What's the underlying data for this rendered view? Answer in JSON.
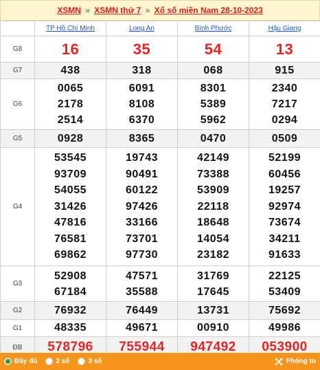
{
  "header": {
    "link1": "XSMN",
    "sep": "»",
    "link2": "XSMN thứ 7",
    "link3": "Xổ số miền Nam 28-10-2023"
  },
  "provinces": [
    "TP Hồ Chí Minh",
    "Long An",
    "Bình Phước",
    "Hậu Giang"
  ],
  "prizes": [
    {
      "label": "G8",
      "results": [
        [
          "16"
        ],
        [
          "35"
        ],
        [
          "54"
        ],
        [
          "13"
        ]
      ]
    },
    {
      "label": "G7",
      "results": [
        [
          "438"
        ],
        [
          "318"
        ],
        [
          "068"
        ],
        [
          "915"
        ]
      ]
    },
    {
      "label": "G6",
      "results": [
        [
          "0065",
          "2178",
          "2514"
        ],
        [
          "6091",
          "8108",
          "6370"
        ],
        [
          "8301",
          "5389",
          "5962"
        ],
        [
          "2340",
          "7217",
          "0294"
        ]
      ]
    },
    {
      "label": "G5",
      "results": [
        [
          "0928"
        ],
        [
          "8365"
        ],
        [
          "0470"
        ],
        [
          "0509"
        ]
      ]
    },
    {
      "label": "G4",
      "results": [
        [
          "53545",
          "93709",
          "54055",
          "31426",
          "47816",
          "76581",
          "69862"
        ],
        [
          "19743",
          "90491",
          "60122",
          "97426",
          "33166",
          "73701",
          "97730"
        ],
        [
          "42149",
          "73388",
          "53909",
          "22118",
          "18648",
          "14054",
          "23182"
        ],
        [
          "52199",
          "60456",
          "19257",
          "92974",
          "73674",
          "34211",
          "91633"
        ]
      ]
    },
    {
      "label": "G3",
      "results": [
        [
          "52908",
          "67184"
        ],
        [
          "47571",
          "35588"
        ],
        [
          "31769",
          "17645"
        ],
        [
          "22125",
          "53409"
        ]
      ]
    },
    {
      "label": "G2",
      "results": [
        [
          "76932"
        ],
        [
          "76449"
        ],
        [
          "13731"
        ],
        [
          "75692"
        ]
      ]
    },
    {
      "label": "G1",
      "results": [
        [
          "48335"
        ],
        [
          "49671"
        ],
        [
          "00910"
        ],
        [
          "49986"
        ]
      ]
    },
    {
      "label": "ĐB",
      "results": [
        [
          "578796"
        ],
        [
          "755944"
        ],
        [
          "947492"
        ],
        [
          "053900"
        ]
      ]
    }
  ],
  "footer": {
    "options": [
      {
        "label": "Đầy đủ",
        "selected": true
      },
      {
        "label": "2 số",
        "selected": false
      },
      {
        "label": "3 số",
        "selected": false
      }
    ],
    "zoom_label": "Phóng to"
  },
  "colors": {
    "accent_red": "#e02525",
    "footer_orange": "#f6951b",
    "header_bg": "#fff6cf",
    "link_blue": "#2057b5"
  }
}
